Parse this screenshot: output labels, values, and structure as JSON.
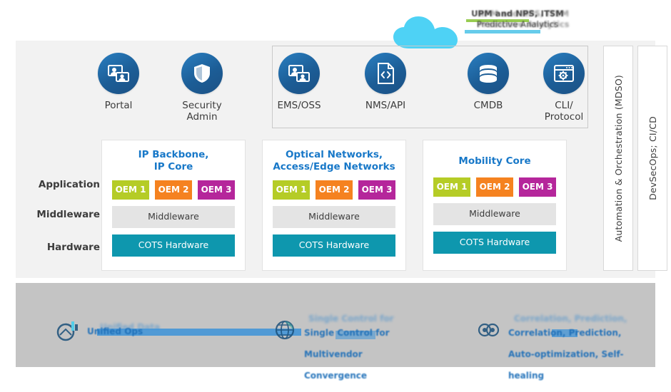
{
  "banner": {
    "line1": "UPM and NPS, ITSM",
    "line2": "Predictive Analytics",
    "ghost_line1": "NPM and NPS, ITSM",
    "ghost_line2": "Predictive Analytics",
    "cloud_icon": "cloud-icon",
    "cloud_color": "#4ed2f5",
    "highlight1_color": "#8dc63f",
    "highlight2_color": "#4bc3e8"
  },
  "top_icons": {
    "left": [
      {
        "label": "Portal",
        "icon": "portal-screen-user-icon"
      },
      {
        "label": "Security\nAdmin",
        "label_l1": "Security",
        "label_l2": "Admin",
        "icon": "shield-icon"
      }
    ],
    "grouped": [
      {
        "label": "EMS/OSS",
        "icon": "ems-screen-user-icon"
      },
      {
        "label": "NMS/API",
        "icon": "code-document-icon"
      },
      {
        "label": "CMDB",
        "icon": "database-icon"
      },
      {
        "label_l1": "CLI/",
        "label_l2": "Protocol",
        "icon": "console-gear-icon"
      }
    ]
  },
  "row_labels": [
    "Application",
    "Middleware",
    "Hardware"
  ],
  "stacks": [
    {
      "title_l1": "IP Backbone,",
      "title_l2": "IP Core",
      "oems": [
        "OEM 1",
        "OEM 2",
        "OEM 3"
      ],
      "middleware": "Middleware",
      "hardware": "COTS Hardware"
    },
    {
      "title_l1": "Optical Networks,",
      "title_l2": "Access/Edge Networks",
      "oems": [
        "OEM 1",
        "OEM 2",
        "OEM 3"
      ],
      "middleware": "Middleware",
      "hardware": "COTS Hardware"
    },
    {
      "title_l1": "Mobility Core",
      "title_l2": "",
      "oems": [
        "OEM 1",
        "OEM 2",
        "OEM 3"
      ],
      "middleware": "Middleware",
      "hardware": "COTS Hardware"
    }
  ],
  "side_panels": [
    {
      "label": "Automation & Orchestration (MDSO)"
    },
    {
      "label": "DevSecOps; CI/CD"
    }
  ],
  "footer": [
    {
      "line1": "Unified Ops",
      "line2": "",
      "ghost1": "Unified Data",
      "ghost2": "",
      "icon": "unified-ops-icon"
    },
    {
      "line1": "Single Control for",
      "line2": "Multivendor",
      "line3": "Convergence",
      "ghost1": "Single Control for",
      "ghost2": "Multivendor",
      "icon": "globe-network-icon"
    },
    {
      "line1": "Correlation, Prediction,",
      "line2": "Auto-optimization, Self-",
      "line3": "healing",
      "ghost1": "Correlation, Prediction,",
      "ghost2": "Auto-optimization",
      "icon": "analytics-loop-icon"
    }
  ],
  "palette": {
    "oem1": "#b5cc26",
    "oem2": "#f58220",
    "oem3": "#b5269b",
    "middleware": "#e4e4e4",
    "hardware": "#0e97ae",
    "stack_title": "#1878c8",
    "icon_circle": "#1c5d96",
    "panel_bg": "#f2f2f2",
    "bottom_bg": "#c4c4c4"
  }
}
